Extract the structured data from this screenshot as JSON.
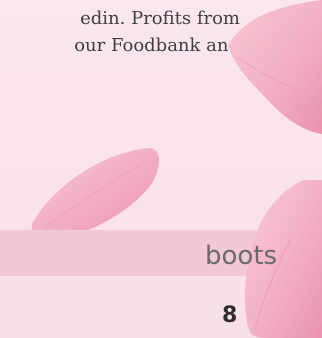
{
  "body_text": {
    "line_1": "edin. Profits from",
    "line_2": "our Foodbank and"
  },
  "band": {
    "label": "boots"
  },
  "page_number": "8",
  "colors": {
    "background": "#fbe4ea",
    "band": "#f3c8d5",
    "petal": "#f2a9bf"
  }
}
